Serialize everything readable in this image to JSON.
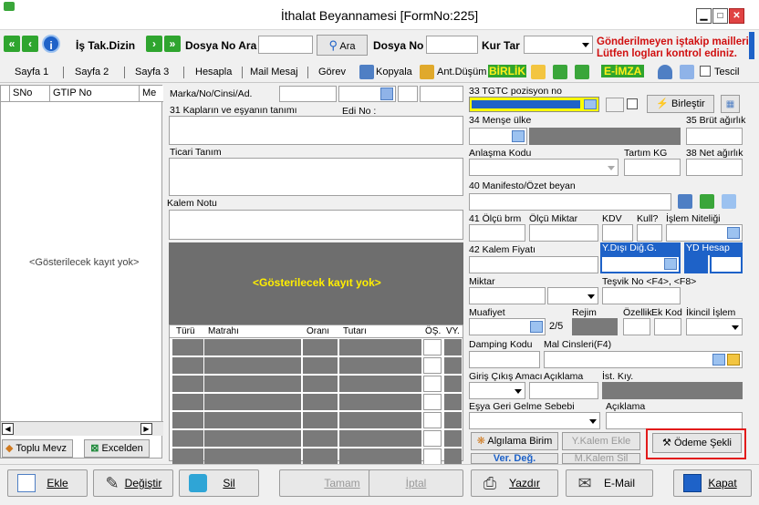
{
  "window": {
    "title": "İthalat Beyannamesi [FormNo:225]"
  },
  "toolbar": {
    "is_takip_label": "İş Tak.Dizin",
    "dosya_no_ara_label": "Dosya No Ara",
    "ara_label": "Ara",
    "dosya_no_label": "Dosya No",
    "kur_tar_label": "Kur Tar",
    "warning_line1": "Gönderilmeyen iştakip mailleri",
    "warning_line2": "Lütfen logları kontrol ediniz."
  },
  "tabs": {
    "sayfa1": "Sayfa 1",
    "sayfa2": "Sayfa 2",
    "sayfa3": "Sayfa 3",
    "hesapla": "Hesapla",
    "mail": "Mail Mesaj",
    "gorev": "Görev",
    "kopyala": "Kopyala",
    "ant": "Ant.Düşüm",
    "birlik": "BİRLİK",
    "eimza": "E-İMZA",
    "tescil": "Tescil"
  },
  "left_grid": {
    "columns": [
      "SNo",
      "GTIP No",
      "Me"
    ],
    "empty_text": "<Gösterilecek kayıt yok>",
    "toplu_mevz": "Toplu Mevz",
    "excelden": "Excelden"
  },
  "middle": {
    "marka_label": "Marka/No/Cinsi/Ad.",
    "kaplar_label": "31 Kapların ve eşyanın tanımı",
    "edi_no_label": "Edi No :",
    "ticari_tanim_label": "Ticari Tanım",
    "kalem_notu_label": "Kalem Notu",
    "empty_text": "<Gösterilecek kayıt yok>",
    "tax_columns": [
      "Türü",
      "Matrahı",
      "Oranı",
      "Tutarı",
      "ÖŞ.",
      "VY."
    ]
  },
  "right": {
    "gtc_label": "33 TGTC pozisyon no",
    "birlestir": "Birleştir",
    "mense_label": "34 Menşe ülke",
    "brut_label": "35 Brüt ağırlık",
    "anlasma_label": "Anlaşma Kodu",
    "tartim_label": "Tartım KG",
    "net_label": "38 Net ağırlık",
    "manifesto_label": "40 Manifesto/Özet beyan",
    "olcu_label": "41 Ölçü brm",
    "olcu_miktar_label": "Ölçü Miktar",
    "kdv_label": "KDV",
    "kull_label": "Kull?",
    "islem_label": "İşlem Niteliği",
    "fiyat_label": "42 Kalem Fiyatı",
    "ydisi_label": "Y.Dışı Diğ.G.",
    "yd_hesap_label": "YD Hesap",
    "miktar_label": "Miktar",
    "tesvik_label": "Teşvik No <F4>, <F8>",
    "muafiyet_label": "Muafiyet",
    "rejim_label": "Rejim",
    "ozellik_label": "Özellik",
    "ek_kod_label": "Ek Kod",
    "ikincil_label": "İkincil İşlem",
    "page_indicator": "2/5",
    "damping_label": "Damping Kodu",
    "mal_cinsleri_label": "Mal Cinsleri(F4)",
    "giris_label": "Giriş Çıkış Amacı",
    "aciklama_label": "Açıklama",
    "ist_kiy_label": "İst. Kıy.",
    "esya_label": "Eşya Geri Gelme Sebebi",
    "aciklama2_label": "Açıklama",
    "alg_birim": "Algılama Birim",
    "ykalem": "Y.Kalem Ekle",
    "odeme": "Ödeme Şekli",
    "ver_deg": "Ver. Değ.",
    "mkalem_sil": "M.Kalem Sil"
  },
  "bottom": {
    "ekle": "Ekle",
    "degistir": "Değiştir",
    "sil": "Sil",
    "tamam": "Tamam",
    "iptal": "İptal",
    "yazdir": "Yazdır",
    "email": "E-Mail",
    "kapat": "Kapat"
  }
}
